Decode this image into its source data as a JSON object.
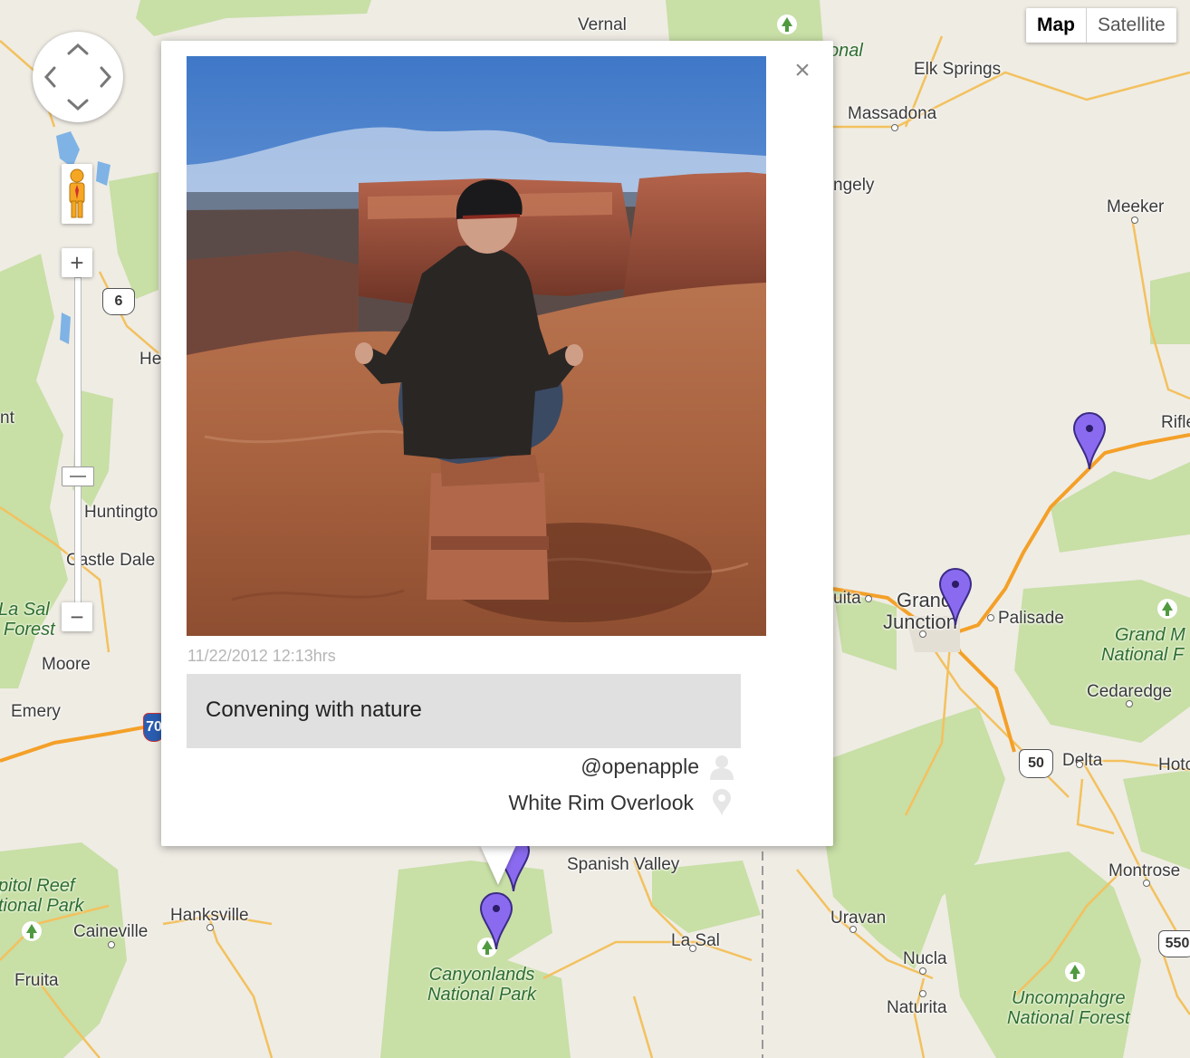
{
  "map_type": {
    "map_label": "Map",
    "satellite_label": "Satellite",
    "active": "Map"
  },
  "zoom": {
    "in_label": "+",
    "out_label": "−"
  },
  "places": {
    "vernal": "Vernal",
    "dinosaur": "onal",
    "elk_springs": "Elk Springs",
    "massadona": "Massadona",
    "rangely": "ngely",
    "meeker": "Meeker",
    "rifle": "Rifle",
    "he": "He",
    "nt": "nt",
    "huntington": "Huntingto",
    "castle_dale": "Castle Dale",
    "moore": "Moore",
    "emery": "Emery",
    "fruita": "uita",
    "grand": "Grand",
    "junction": "Junction",
    "palisade": "Palisade",
    "cedaredge": "Cedaredge",
    "delta": "Delta",
    "hotchkiss": "Hotc",
    "spanish_valley": "Spanish Valley",
    "hanksville": "Hanksville",
    "caineville": "Caineville",
    "fruita_ut": "Fruita",
    "uravan": "Uravan",
    "la_sal": "La Sal",
    "nucla": "Nucla",
    "naturita": "Naturita",
    "montrose": "Montrose"
  },
  "parks": {
    "la_sal_forest_1": "La Sal",
    "la_sal_forest_2": "Forest",
    "capitol_reef_1": "pitol Reef",
    "capitol_reef_2": "tional Park",
    "canyonlands_1": "Canyonlands",
    "canyonlands_2": "National Park",
    "grand_mesa_1": "Grand M",
    "grand_mesa_2": "National F",
    "uncompahgre_1": "Uncompahgre",
    "uncompahgre_2": "National Forest"
  },
  "shields": {
    "us6": "6",
    "i70": "70",
    "us50": "50",
    "us550": "550"
  },
  "colors": {
    "marker": "#8a6bf0",
    "highway": "#f4a028",
    "road": "#f3c15e",
    "park": "#c8dfa6",
    "land": "#efece4",
    "water": "#7fb3e6"
  },
  "info_window": {
    "timestamp": "11/22/2012 12:13hrs",
    "caption": "Convening with nature",
    "username": "@openapple",
    "location": "White Rim Overlook",
    "close_label": "×",
    "photo_icon": "photo-person-meditating-on-canyon-rim",
    "user_icon": "user-icon",
    "location_icon": "location-pin-icon"
  }
}
